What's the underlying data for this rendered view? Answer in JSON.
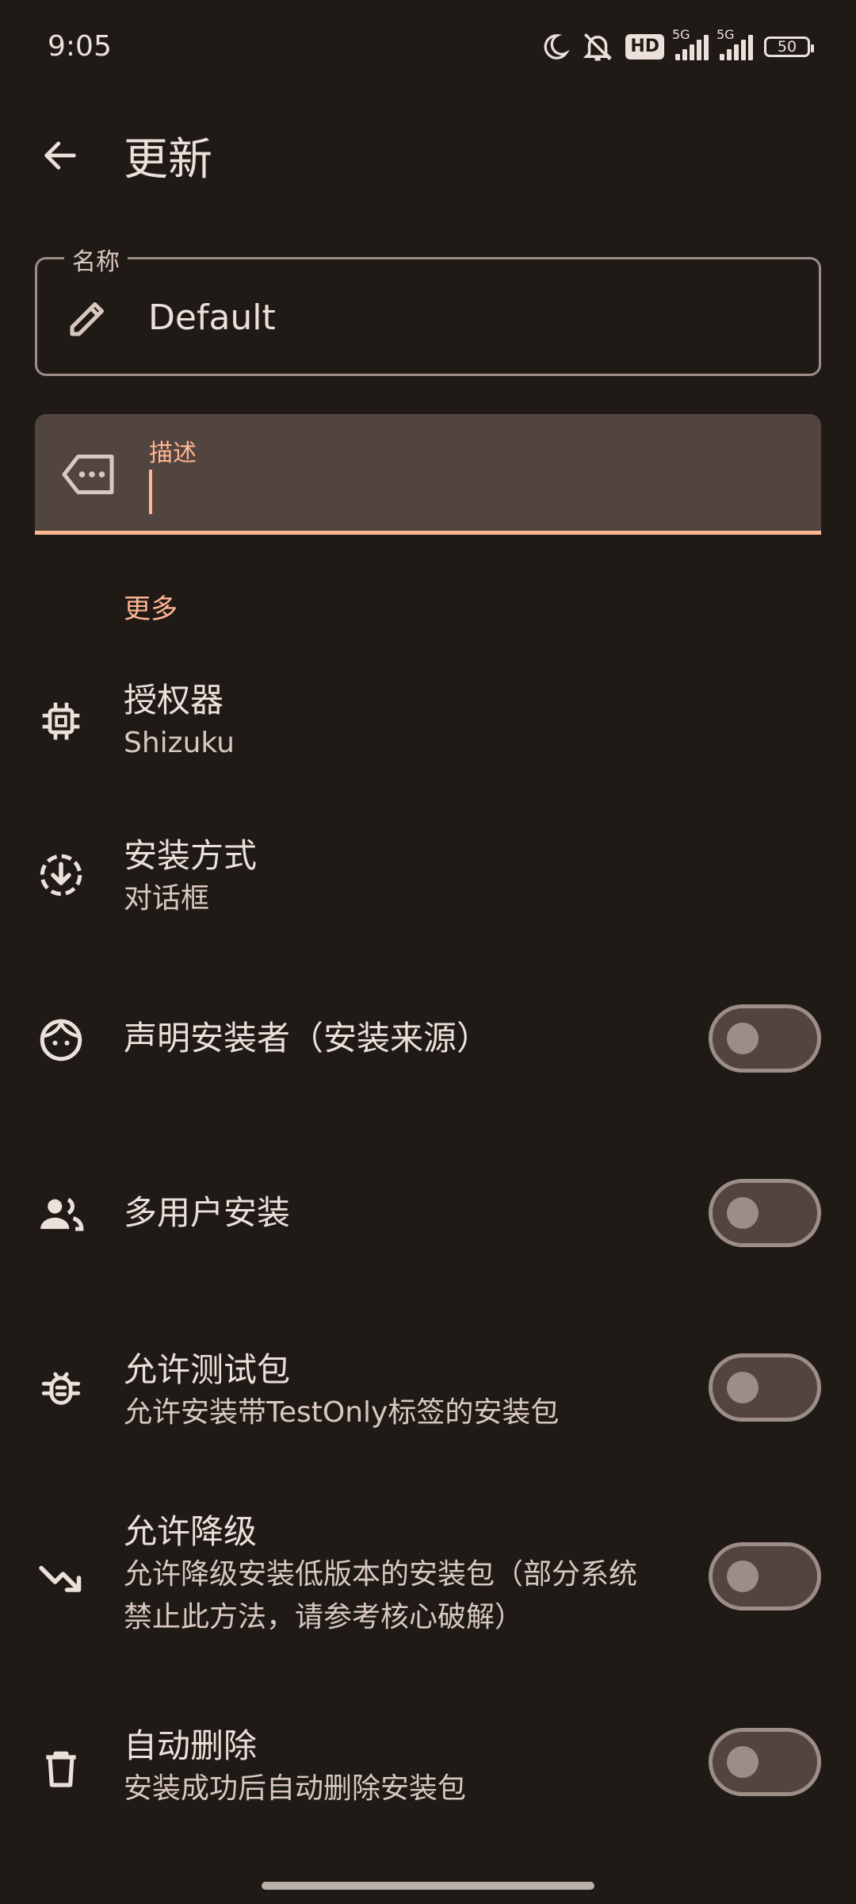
{
  "status_bar": {
    "time": "9:05",
    "hd_badge": "HD",
    "network_1": "5G",
    "network_2": "5G",
    "battery": "50"
  },
  "app_bar": {
    "title": "更新"
  },
  "name_field": {
    "label": "名称",
    "value": "Default",
    "icon": "pencil-icon"
  },
  "desc_field": {
    "label": "描述",
    "value": "",
    "icon": "label-tag-icon"
  },
  "section": {
    "title": "更多"
  },
  "settings": [
    {
      "title": "授权器",
      "subtitle": "Shizuku",
      "icon": "chip-icon"
    },
    {
      "title": "安装方式",
      "subtitle": "对话框",
      "icon": "install-download-icon"
    },
    {
      "title": "声明安装者（安装来源）",
      "icon": "face-icon",
      "toggle": false
    },
    {
      "title": "多用户安装",
      "icon": "users-icon",
      "toggle": false
    },
    {
      "title": "允许测试包",
      "subtitle": "允许安装带TestOnly标签的安装包",
      "icon": "bug-icon",
      "toggle": false
    },
    {
      "title": "允许降级",
      "subtitle_line1": "允许降级安装低版本的安装包（部分系统",
      "subtitle_line2": "禁止此方法，请参考核心破解）",
      "icon": "trending-down-icon",
      "toggle": false
    },
    {
      "title": "自动删除",
      "subtitle": "安装成功后自动删除安装包",
      "icon": "trash-icon",
      "toggle": false
    }
  ],
  "colors": {
    "background": "#201a17",
    "accent": "#ffb692",
    "text": "#ece0da",
    "field_fill": "#52443e",
    "outline": "#9c8d87"
  }
}
